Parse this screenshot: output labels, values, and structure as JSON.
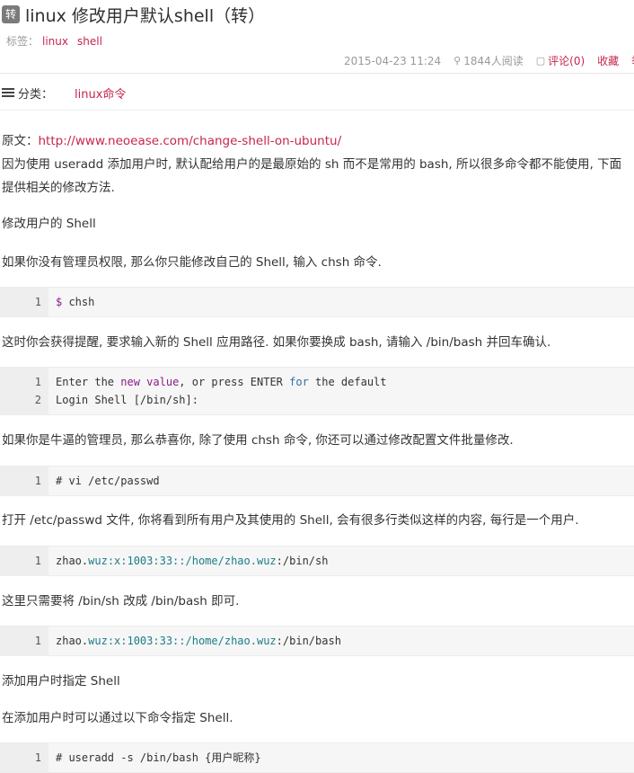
{
  "header": {
    "badge": "转",
    "title": "linux 修改用户默认shell（转）",
    "tags_label": "标签：",
    "tags": [
      "linux",
      "shell"
    ],
    "date": "2015-04-23 11:24",
    "reads": "1844人阅读",
    "comments": "评论(0)",
    "favorite": "收藏",
    "report": "举报"
  },
  "category": {
    "label": "分类：",
    "value": "linux命令"
  },
  "article": {
    "source_prefix": "原文：",
    "source_url": "http://www.neoease.com/change-shell-on-ubuntu/",
    "p1a": "因为使用 useradd 添加用户时, 默认配给用户的是最原始的 sh 而不是常用的 bash, 所以很多命令都不能使用, 下面",
    "p1b": "提供相关的修改方法.",
    "h1": "修改用户的 Shell",
    "p2": "如果你没有管理员权限, 那么你只能修改自己的 Shell, 输入 chsh 命令.",
    "code1": {
      "ln": "1",
      "prompt": "$",
      "cmd": " chsh"
    },
    "p3": "这时你会获得提醒, 要求输入新的 Shell 应用路径. 如果你要换成 bash, 请输入 /bin/bash 并回车确认.",
    "code2": {
      "l1": "1",
      "l2": "2",
      "a1": "Enter the ",
      "a2": "new",
      "a3": " ",
      "a4": "value",
      "a5": ", or press ENTER ",
      "a6": "for",
      "a7": " the default",
      "b": "Login Shell [/bin/sh]:"
    },
    "p4": "如果你是牛逼的管理员, 那么恭喜你, 除了使用 chsh 命令, 你还可以通过修改配置文件批量修改.",
    "code3": {
      "ln": "1",
      "text": "# vi /etc/passwd"
    },
    "p5": "打开 /etc/passwd 文件, 你将看到所有用户及其使用的 Shell, 会有很多行类似这样的内容, 每行是一个用户.",
    "code4": {
      "ln": "1",
      "a": "zhao.",
      "b": "wuz",
      "c": ":x:1003:33::/home/zhao.",
      "d": "wuz",
      "e": ":/bin/sh"
    },
    "p6": "这里只需要将 /bin/sh 改成 /bin/bash 即可.",
    "code5": {
      "ln": "1",
      "a": "zhao.",
      "b": "wuz",
      "c": ":x:1003:33::/home/zhao.",
      "d": "wuz",
      "e": ":/bin/bash"
    },
    "h2": "添加用户时指定 Shell",
    "p7": "在添加用户时可以通过以下命令指定 Shell.",
    "code6": {
      "ln": "1",
      "text": "# useradd -s /bin/bash {用户昵称}"
    }
  }
}
